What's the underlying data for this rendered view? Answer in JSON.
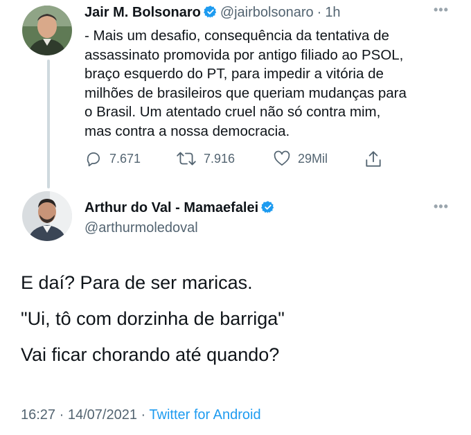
{
  "tweet": {
    "author_name": "Jair M. Bolsonaro",
    "handle": "@jairbolsonaro",
    "separator": "·",
    "time": "1h",
    "text": "- Mais um desafio, consequência da tentativa de\nassassinato promovida por antigo filiado ao PSOL,\nbraço esquerdo do PT, para impedir a vitória de\nmilhões de brasileiros que queriam mudanças para\no Brasil. Um atentado cruel não só contra mim,\nmas contra a nossa democracia.",
    "replies": "7.671",
    "retweets": "7.916",
    "likes": "29Mil"
  },
  "reply": {
    "author_name": "Arthur do Val - Mamaefalei",
    "handle": "@arthurmoledoval",
    "lines": [
      "E daí? Para de ser maricas.",
      "\"Ui, tô com dorzinha de barriga\"",
      "Vai ficar chorando até quando?"
    ],
    "time": "16:27",
    "separator1": "·",
    "date": "14/07/2021",
    "separator2": "·",
    "source": "Twitter for Android"
  },
  "icons": {
    "more": "more-dots-icon",
    "verified": "verified-badge-icon",
    "reply": "comment-icon",
    "retweet": "retweet-icon",
    "like": "heart-icon",
    "share": "share-icon"
  },
  "colors": {
    "accent": "#1d9bf0",
    "secondary_text": "#536471",
    "thread_line": "#cfd9de"
  }
}
